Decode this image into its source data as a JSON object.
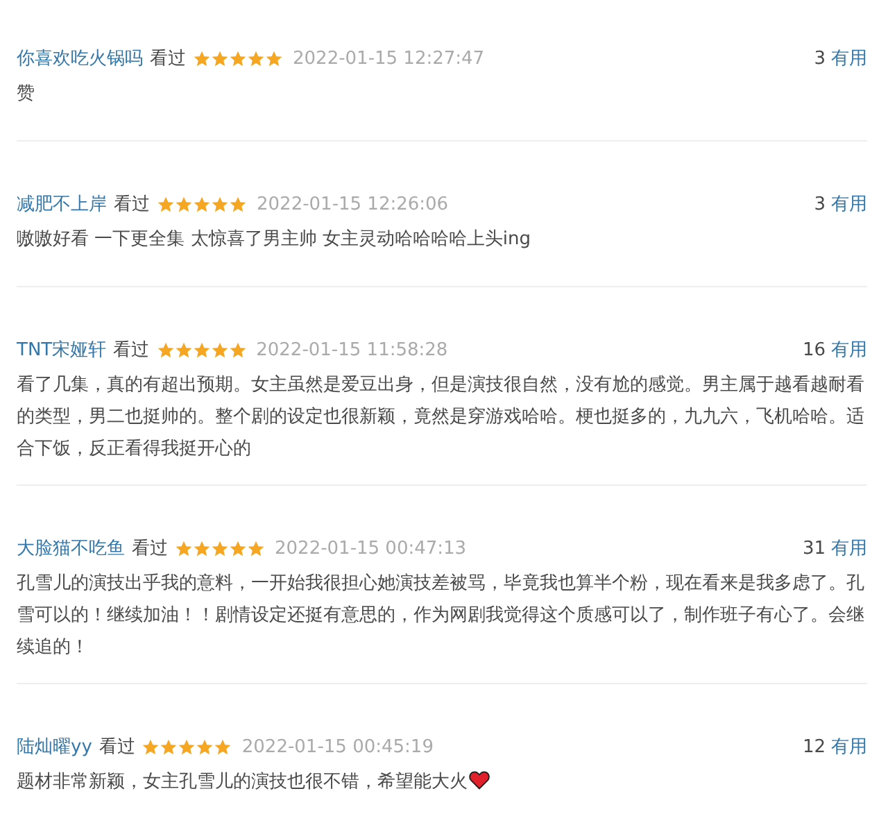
{
  "comments": [
    {
      "user": "你喜欢吃火锅吗",
      "status": "看过",
      "stars": 5,
      "time": "2022-01-15 12:27:47",
      "votes": "3",
      "vote_link": "有用",
      "text": "赞"
    },
    {
      "user": "减肥不上岸",
      "status": "看过",
      "stars": 5,
      "time": "2022-01-15 12:26:06",
      "votes": "3",
      "vote_link": "有用",
      "text": "嗷嗷好看 一下更全集 太惊喜了男主帅 女主灵动哈哈哈哈上头ing"
    },
    {
      "user": "TNT宋娅轩",
      "status": "看过",
      "stars": 5,
      "time": "2022-01-15 11:58:28",
      "votes": "16",
      "vote_link": "有用",
      "text": "看了几集，真的有超出预期。女主虽然是爱豆出身，但是演技很自然，没有尬的感觉。男主属于越看越耐看的类型，男二也挺帅的。整个剧的设定也很新颖，竟然是穿游戏哈哈。梗也挺多的，九九六，飞机哈哈。适合下饭，反正看得我挺开心的"
    },
    {
      "user": "大脸猫不吃鱼",
      "status": "看过",
      "stars": 5,
      "time": "2022-01-15 00:47:13",
      "votes": "31",
      "vote_link": "有用",
      "text": "孔雪儿的演技出乎我的意料，一开始我很担心她演技差被骂，毕竟我也算半个粉，现在看来是我多虑了。孔雪可以的！继续加油！！剧情设定还挺有意思的，作为网剧我觉得这个质感可以了，制作班子有心了。会继续追的！"
    },
    {
      "user": "陆灿曜yy",
      "status": "看过",
      "stars": 5,
      "time": "2022-01-15 00:45:19",
      "votes": "12",
      "vote_link": "有用",
      "text": "题材非常新颖，女主孔雪儿的演技也很不错，希望能大火",
      "heart": true
    }
  ]
}
